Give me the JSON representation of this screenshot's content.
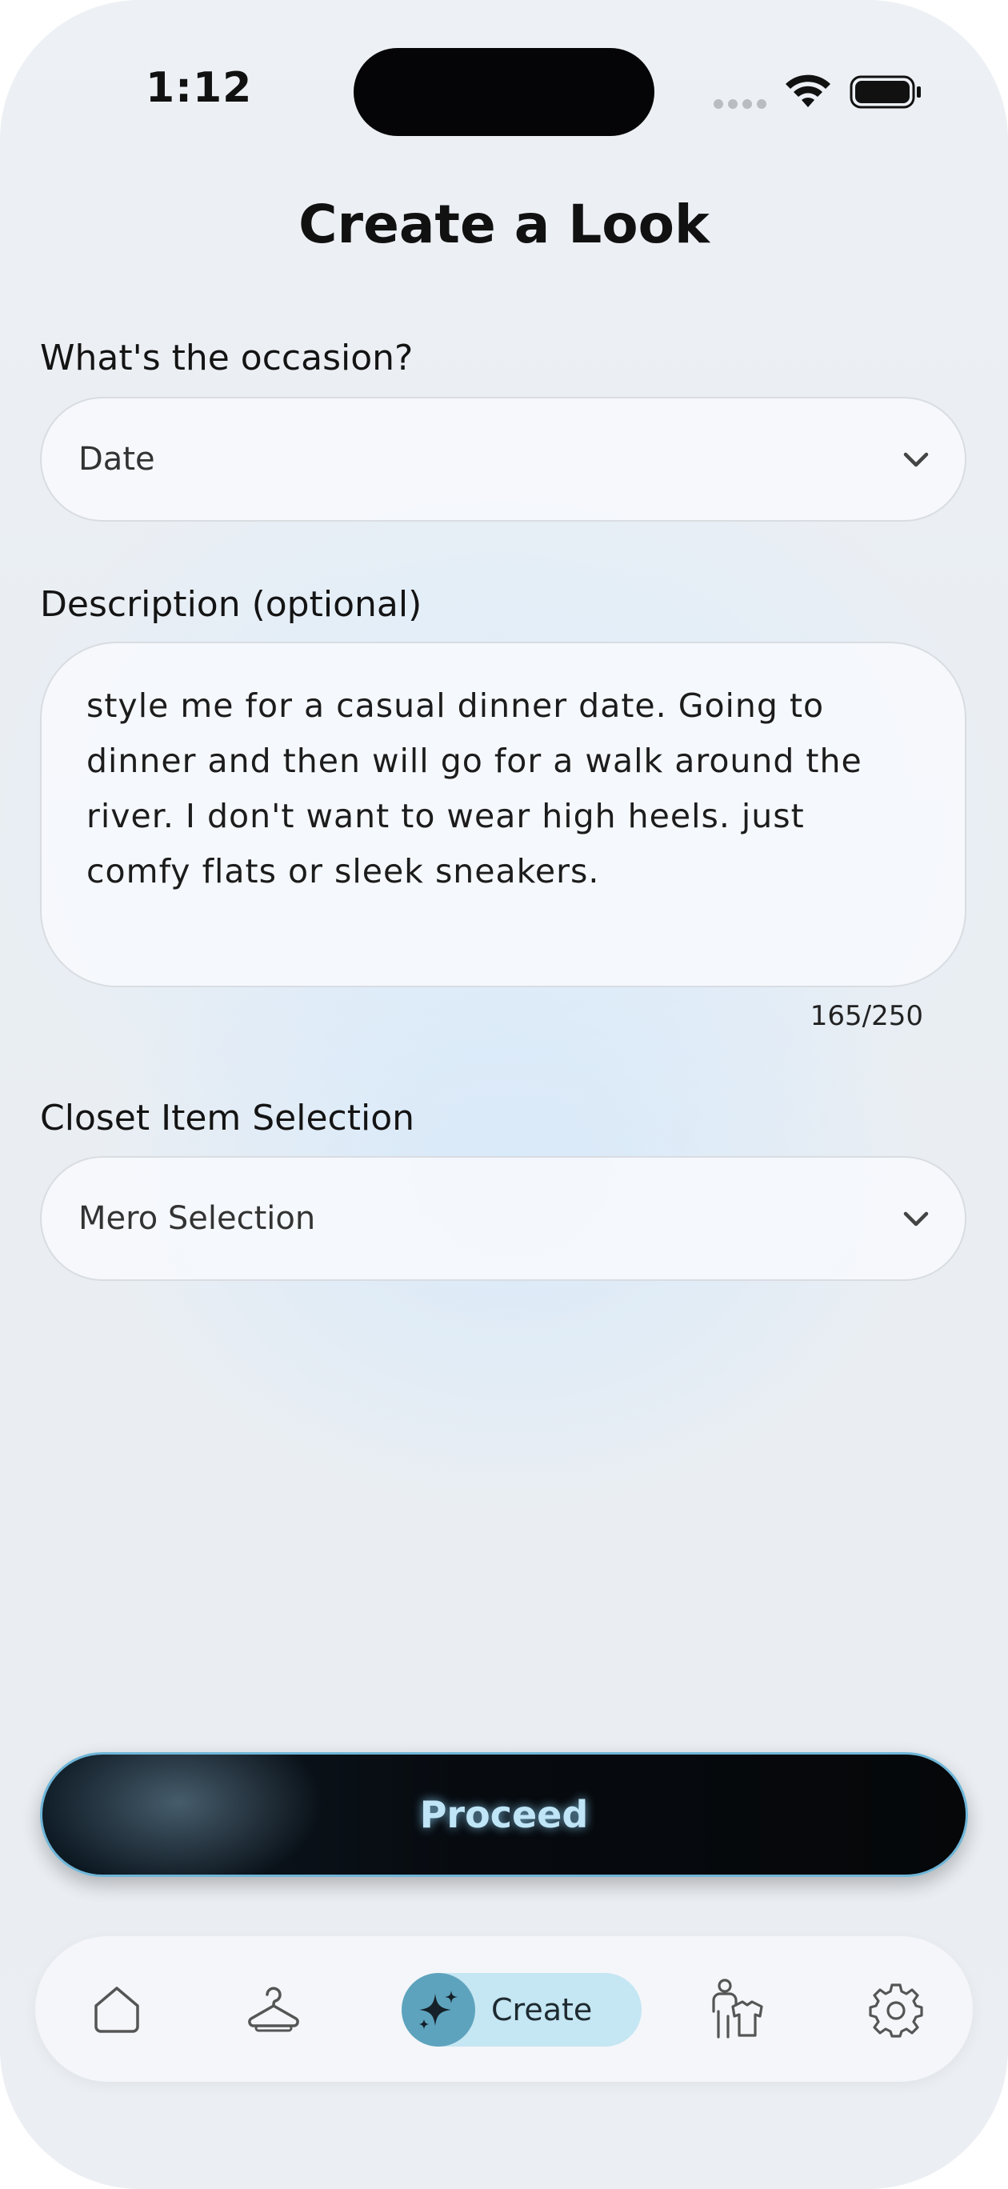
{
  "status_bar": {
    "time": "1:12"
  },
  "page": {
    "title": "Create a Look"
  },
  "occasion": {
    "label": "What's the occasion?",
    "value": "Date"
  },
  "description": {
    "label": "Description (optional)",
    "value": "style me for a casual dinner date. Going to dinner and then will go for a walk around the river. I don't want to wear high heels. just comfy flats or sleek sneakers.",
    "counter": "165/250"
  },
  "closet": {
    "label": "Closet Item Selection",
    "value": "Mero Selection"
  },
  "actions": {
    "proceed_label": "Proceed"
  },
  "tab_bar": {
    "items": [
      {
        "icon": "home-icon"
      },
      {
        "icon": "hanger-icon"
      },
      {
        "icon": "sparkles-icon",
        "label": "Create",
        "active": true
      },
      {
        "icon": "dressing-person-icon"
      },
      {
        "icon": "gear-icon"
      }
    ]
  },
  "colors": {
    "accent": "#5ea3bd",
    "accent_light": "#c5e6f3",
    "button_dark": "#070b10",
    "button_text": "#bfe5f7"
  }
}
